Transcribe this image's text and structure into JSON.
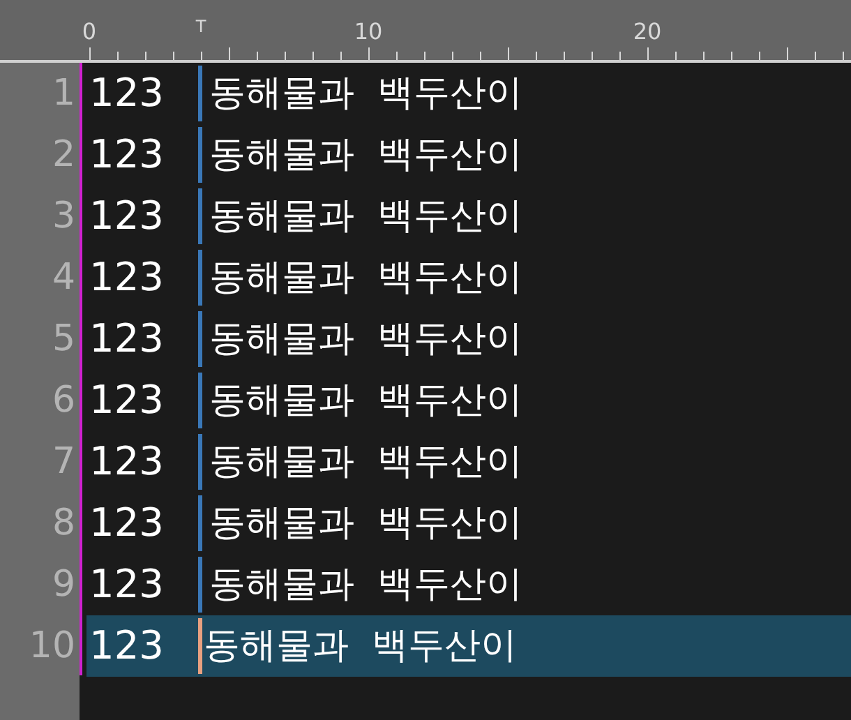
{
  "ruler": {
    "labels": [
      "0",
      "10",
      "20"
    ],
    "tab_marker": "T"
  },
  "lines": [
    {
      "number": "1",
      "column_1": "123",
      "column_2": "동해물과  백두산이",
      "selected": false
    },
    {
      "number": "2",
      "column_1": "123",
      "column_2": "동해물과  백두산이",
      "selected": false
    },
    {
      "number": "3",
      "column_1": "123",
      "column_2": "동해물과  백두산이",
      "selected": false
    },
    {
      "number": "4",
      "column_1": "123",
      "column_2": "동해물과  백두산이",
      "selected": false
    },
    {
      "number": "5",
      "column_1": "123",
      "column_2": "동해물과  백두산이",
      "selected": false
    },
    {
      "number": "6",
      "column_1": "123",
      "column_2": "동해물과  백두산이",
      "selected": false
    },
    {
      "number": "7",
      "column_1": "123",
      "column_2": "동해물과  백두산이",
      "selected": false
    },
    {
      "number": "8",
      "column_1": "123",
      "column_2": "동해물과  백두산이",
      "selected": false
    },
    {
      "number": "9",
      "column_1": "123",
      "column_2": "동해물과  백두산이",
      "selected": false
    },
    {
      "number": "10",
      "column_1": "123",
      "column_2": "동해물과  백두산이",
      "selected": true
    }
  ]
}
